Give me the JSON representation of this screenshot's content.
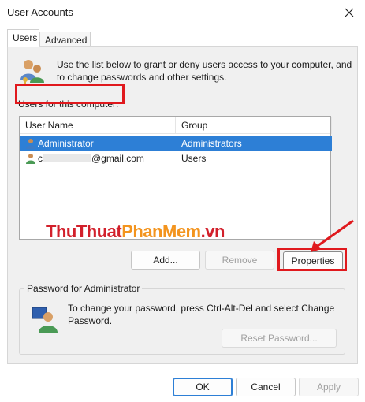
{
  "window": {
    "title": "User Accounts",
    "close_icon": "close-icon"
  },
  "tabs": [
    {
      "label": "Users",
      "active": true
    },
    {
      "label": "Advanced",
      "active": false
    }
  ],
  "intro_text": "Use the list below to grant or deny users access to your computer, and to change passwords and other settings.",
  "users_list": {
    "label": "Users for this computer:",
    "columns": [
      "User Name",
      "Group"
    ],
    "rows": [
      {
        "name": "Administrator",
        "group": "Administrators",
        "selected": true
      },
      {
        "name_prefix": "c",
        "name_suffix": "@gmail.com",
        "group": "Users",
        "selected": false
      }
    ]
  },
  "watermark": {
    "part1": "ThuThuat",
    "part2": "PhanMem",
    "part3": ".vn"
  },
  "buttons": {
    "add": "Add...",
    "remove": "Remove",
    "properties": "Properties"
  },
  "password": {
    "title": "Password for Administrator",
    "text": "To change your password, press Ctrl-Alt-Del and select Change Password.",
    "reset": "Reset Password..."
  },
  "footer": {
    "ok": "OK",
    "cancel": "Cancel",
    "apply": "Apply"
  },
  "colors": {
    "selection": "#2d7fd6",
    "highlight": "#e0191d",
    "panel": "#f0f0f0"
  }
}
